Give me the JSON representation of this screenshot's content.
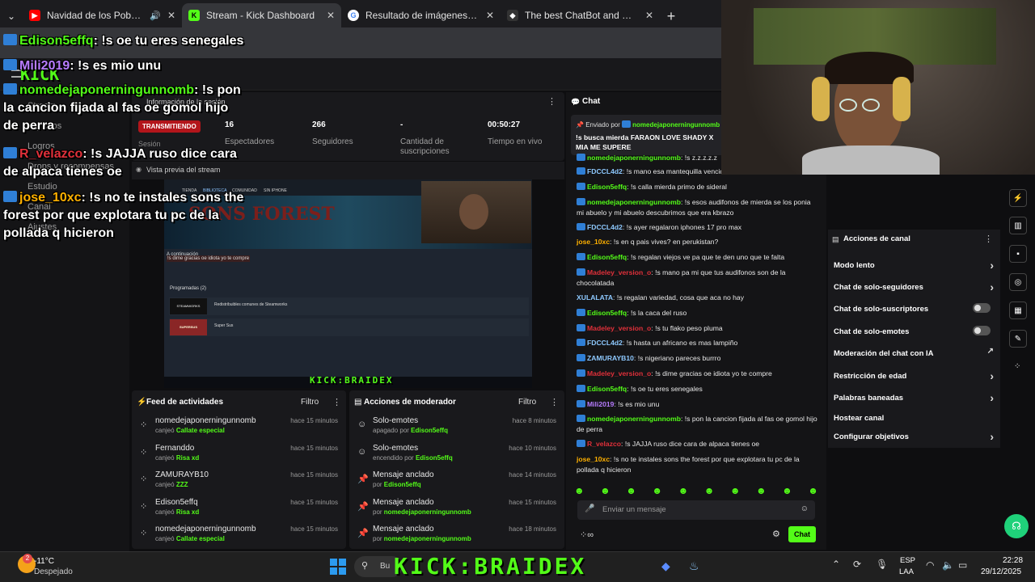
{
  "browser": {
    "tabs": [
      {
        "title": "Navidad de los Pobres - Yo",
        "icon": "youtube-icon",
        "color": "#ff0000"
      },
      {
        "title": "Stream - Kick Dashboard",
        "icon": "kick-icon",
        "color": "#53fc18"
      },
      {
        "title": "Resultado de imágenes de Goo",
        "icon": "google-icon",
        "color": "#4285f4"
      },
      {
        "title": "The best ChatBot and Widgets",
        "icon": "botrix-icon",
        "color": "#ffffff"
      }
    ]
  },
  "nav": {
    "items": [
      "Stream",
      "Ingresos",
      "Logros",
      "Drops y recompensas",
      "Estudio",
      "Canal",
      "Ajustes"
    ]
  },
  "session": {
    "title": "Información de la sesión",
    "status": "TRANSMITIENDO",
    "session_label": "Sesión",
    "stats": [
      {
        "value": "16",
        "label": "Espectadores"
      },
      {
        "value": "266",
        "label": "Seguidores"
      },
      {
        "value": "-",
        "label": "Cantidad de suscripciones"
      },
      {
        "value": "00:50:27",
        "label": "Tiempo en vivo"
      }
    ],
    "preview_label": "Vista previa del stream"
  },
  "preview": {
    "tabs": [
      "TIENDA",
      "BIBLIOTECA",
      "COMUNIDAD",
      "SIN IPHONE"
    ],
    "continue_label": "A continuación",
    "continue_text": "!s dime gracias oe idiota yo te compre",
    "scheduled": "Programadas",
    "scheduled_count": "(2)",
    "items": [
      {
        "name": "Redistribuibles comunes de Steamworks",
        "logo": "STEAMWORKS"
      },
      {
        "name": "Super Sus",
        "logo": "SUPERSUS"
      }
    ],
    "game": "SONS FOREST"
  },
  "feed": {
    "title": "Feed de actividades",
    "filter": "Filtro",
    "rows": [
      {
        "name": "nomedejaponerningunnomb",
        "action": "canjeó",
        "reward": "Callate especial",
        "time": "hace 15 minutos"
      },
      {
        "name": "Fernanddo",
        "action": "canjeó",
        "reward": "Risa xd",
        "time": "hace 15 minutos"
      },
      {
        "name": "ZAMURAYB10",
        "action": "canjeó",
        "reward": "ZZZ",
        "time": "hace 15 minutos"
      },
      {
        "name": "Edison5effq",
        "action": "canjeó",
        "reward": "Risa xd",
        "time": "hace 15 minutos"
      },
      {
        "name": "nomedejaponerningunnomb",
        "action": "canjeó",
        "reward": "Callate especial",
        "time": "hace 15 minutos"
      }
    ]
  },
  "modactions": {
    "title": "Acciones de moderador",
    "filter": "Filtro",
    "rows": [
      {
        "name": "Solo-emotes",
        "action": "apagado por",
        "user": "Edison5effq",
        "time": "hace 8 minutos",
        "icon": "emote-icon"
      },
      {
        "name": "Solo-emotes",
        "action": "encendido por",
        "user": "Edison5effq",
        "time": "hace 10 minutos",
        "icon": "emote-icon"
      },
      {
        "name": "Mensaje anclado",
        "action": "por",
        "user": "Edison5effq",
        "time": "hace 14 minutos",
        "icon": "pin-icon"
      },
      {
        "name": "Mensaje anclado",
        "action": "por",
        "user": "nomedejaponerningunnomb",
        "time": "hace 15 minutos",
        "icon": "pin-icon"
      },
      {
        "name": "Mensaje anclado",
        "action": "por",
        "user": "nomedejaponerningunnomb",
        "time": "hace 18 minutos",
        "icon": "pin-icon"
      }
    ]
  },
  "chat": {
    "title": "Chat",
    "pinned": {
      "label": "Enviado por",
      "user": "nomedejaponerningunnomb",
      "text": "!s busca mierda FARAON LOVE SHADY X MIA ME SUPERE"
    },
    "partial": {
      "user": "nomedejaponerningunnomb",
      "text": "!s z.z.z.z.z"
    },
    "messages": [
      {
        "user": "FDCCL4d2",
        "color": "#8ec9ff",
        "badge": true,
        "text": "!s mano esa mantequilla vencida"
      },
      {
        "user": "Edison5effq",
        "color": "#53fc18",
        "badge": true,
        "text": "!s calla mierda primo de sideral"
      },
      {
        "user": "nomedejaponerningunnomb",
        "color": "#53fc18",
        "badge": true,
        "text": "!s esos audifonos de mierda se los ponia mi abuelo y mi abuelo descubrimos que era kbrazo"
      },
      {
        "user": "FDCCL4d2",
        "color": "#8ec9ff",
        "badge": true,
        "text": "!s ayer regalaron iphones 17 pro max"
      },
      {
        "user": "jose_10xc",
        "color": "#ffb100",
        "badge": false,
        "text": "!s en q pais vives? en perukistan?"
      },
      {
        "user": "Edison5effq",
        "color": "#53fc18",
        "badge": true,
        "text": "!s regalan viejos ve pa que te den uno que te falta"
      },
      {
        "user": "Madeley_version_o",
        "color": "#e0303a",
        "badge": true,
        "text": "!s mano pa mi que tus audifonos son de la chocolatada"
      },
      {
        "user": "XULALATA",
        "color": "#8ec9ff",
        "badge": false,
        "text": "!s regalan variedad, cosa que aca no hay"
      },
      {
        "user": "Edison5effq",
        "color": "#53fc18",
        "badge": true,
        "text": "!s la caca del ruso"
      },
      {
        "user": "Madeley_version_o",
        "color": "#e0303a",
        "badge": true,
        "text": "!s tu flako peso pluma"
      },
      {
        "user": "FDCCL4d2",
        "color": "#8ec9ff",
        "badge": true,
        "text": "!s hasta un africano es mas lampiño"
      },
      {
        "user": "ZAMURAYB10",
        "color": "#8ec9ff",
        "badge": true,
        "text": "!s nigeriano pareces burrro"
      },
      {
        "user": "Madeley_version_o",
        "color": "#e0303a",
        "badge": true,
        "text": "!s dime gracias oe idiota yo te compre"
      },
      {
        "user": "Edison5effq",
        "color": "#53fc18",
        "badge": true,
        "text": "!s oe tu eres senegales"
      },
      {
        "user": "Mili2019",
        "color": "#b77cff",
        "badge": true,
        "text": "!s es mio unu"
      },
      {
        "user": "nomedejaponerningunnomb",
        "color": "#53fc18",
        "badge": true,
        "text": "!s pon la cancion fijada al fas oe gomol hijo de perra"
      },
      {
        "user": "R_velazco",
        "color": "#e0303a",
        "badge": true,
        "text": "!s JAJJA ruso dice cara de alpaca tienes oe"
      },
      {
        "user": "jose_10xc",
        "color": "#ffb100",
        "badge": false,
        "text": "!s no te instales sons the forest por que explotara tu pc de la pollada q hicieron"
      }
    ],
    "input_placeholder": "Enviar un mensaje",
    "send_label": "Chat"
  },
  "channel_actions": {
    "title": "Acciones de canal",
    "items": [
      {
        "label": "Modo lento",
        "kind": "chevron"
      },
      {
        "label": "Chat de solo-seguidores",
        "kind": "chevron"
      },
      {
        "label": "Chat de solo-suscriptores",
        "kind": "toggle"
      },
      {
        "label": "Chat de solo-emotes",
        "kind": "toggle"
      },
      {
        "label": "Moderación del chat con IA",
        "kind": "external"
      },
      {
        "label": "Restricción de edad",
        "kind": "chevron"
      },
      {
        "label": "Palabras baneadas",
        "kind": "chevron"
      },
      {
        "label": "Hostear canal",
        "kind": "none"
      },
      {
        "label": "Configurar objetivos",
        "kind": "chevron"
      }
    ]
  },
  "overlay": {
    "messages": [
      {
        "user": "Edison5effq",
        "color": "#53fc18",
        "text": ": !s oe tu eres senegales"
      },
      {
        "user": "Mili2019",
        "color": "#b77cff",
        "text": ": !s es mio unu"
      },
      {
        "user": "nomedejaponerningunnomb",
        "color": "#53fc18",
        "text": ": !s pon la cancion fijada al fas oe gomol hijo de perra"
      },
      {
        "user": "R_velazco",
        "color": "#e0303a",
        "text": ": !s JAJJA ruso dice cara de alpaca tienes oe"
      },
      {
        "user": "jose_10xc",
        "color": "#ffb100",
        "text": ": !s no te instales sons the forest por que explotara tu pc de la pollada q hicieron"
      }
    ],
    "banner": "KICK:BRAIDEX",
    "logo": "KICK"
  },
  "taskbar": {
    "weather_temp": "-11°C",
    "weather_text": "Despejado",
    "notif_count": "2",
    "search_label": "Bu",
    "lang": "ESP",
    "lang2": "LAA",
    "time": "22:28",
    "date": "29/12/2025"
  }
}
